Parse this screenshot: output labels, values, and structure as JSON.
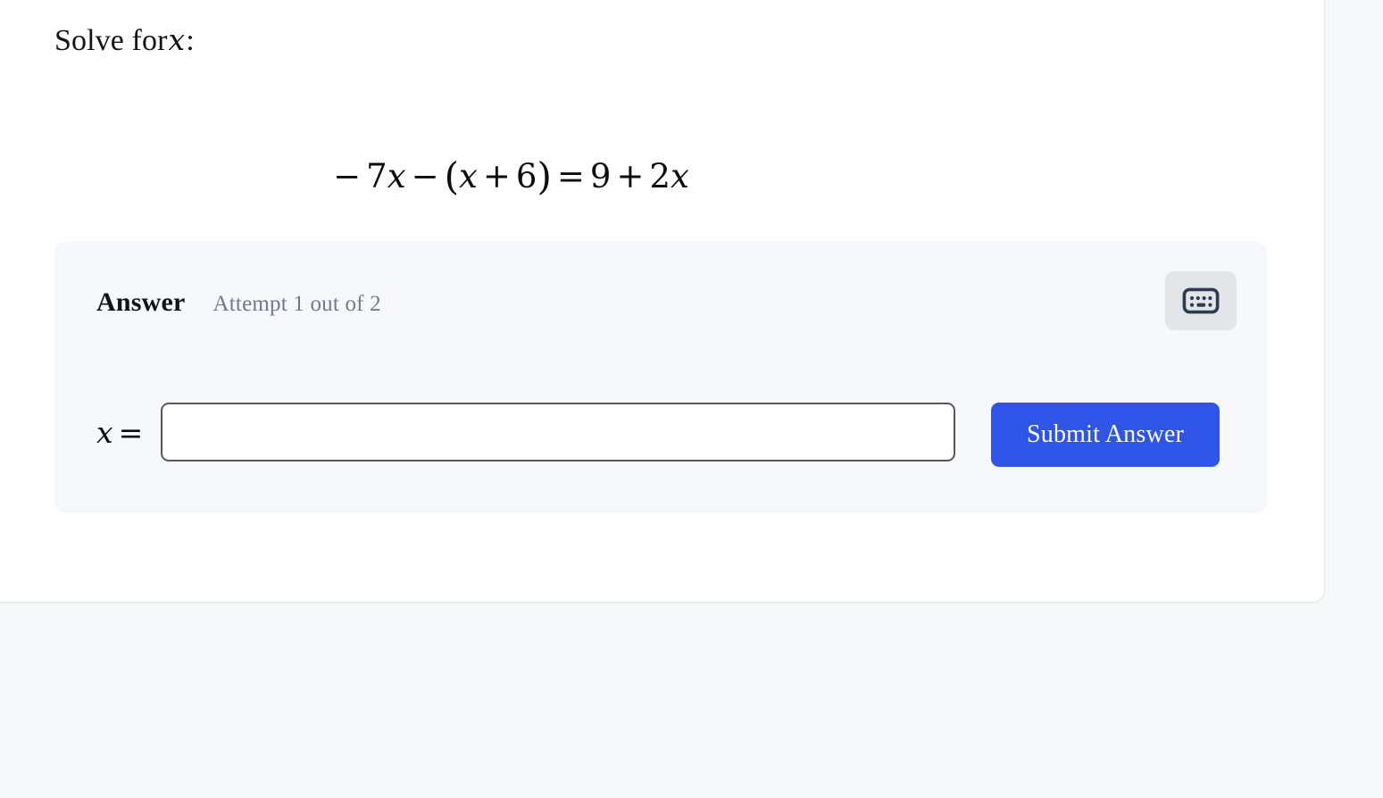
{
  "colors": {
    "page_background": "#f7f8fa",
    "card_background": "#ffffff",
    "panel_background": "#f7f8fb",
    "accent_blue": "#2f55e8",
    "muted_text": "#717a8b",
    "input_border": "#55585f",
    "kbd_button_background": "#e3e5e9",
    "kbd_icon": "#2f3b52"
  },
  "prompt": {
    "lead": "Solve for",
    "variable": "x",
    "trailing": ":"
  },
  "equation": {
    "latex": "-7x - (x + 6) = 9 + 2x",
    "tokens": [
      {
        "type": "mo",
        "text": "−"
      },
      {
        "type": "mn",
        "text": "7"
      },
      {
        "type": "mi",
        "text": "x"
      },
      {
        "type": "mo",
        "text": "−"
      },
      {
        "type": "paren",
        "text": "("
      },
      {
        "type": "mi",
        "text": "x"
      },
      {
        "type": "mo",
        "text": "+"
      },
      {
        "type": "mn",
        "text": "6"
      },
      {
        "type": "paren",
        "text": ")"
      },
      {
        "type": "mo",
        "text": "="
      },
      {
        "type": "mn",
        "text": "9"
      },
      {
        "type": "mo",
        "text": "+"
      },
      {
        "type": "mn",
        "text": "2"
      },
      {
        "type": "mi",
        "text": "x"
      }
    ]
  },
  "answer_panel": {
    "title": "Answer",
    "attempt_text": "Attempt 1 out of 2",
    "attempt_current": "1",
    "attempt_total": "2",
    "keyboard_button": {
      "icon": "keyboard-icon",
      "label": ""
    },
    "variable_label": "x",
    "equals_sign": "=",
    "input": {
      "value": "",
      "placeholder": ""
    },
    "submit_label": "Submit Answer"
  }
}
